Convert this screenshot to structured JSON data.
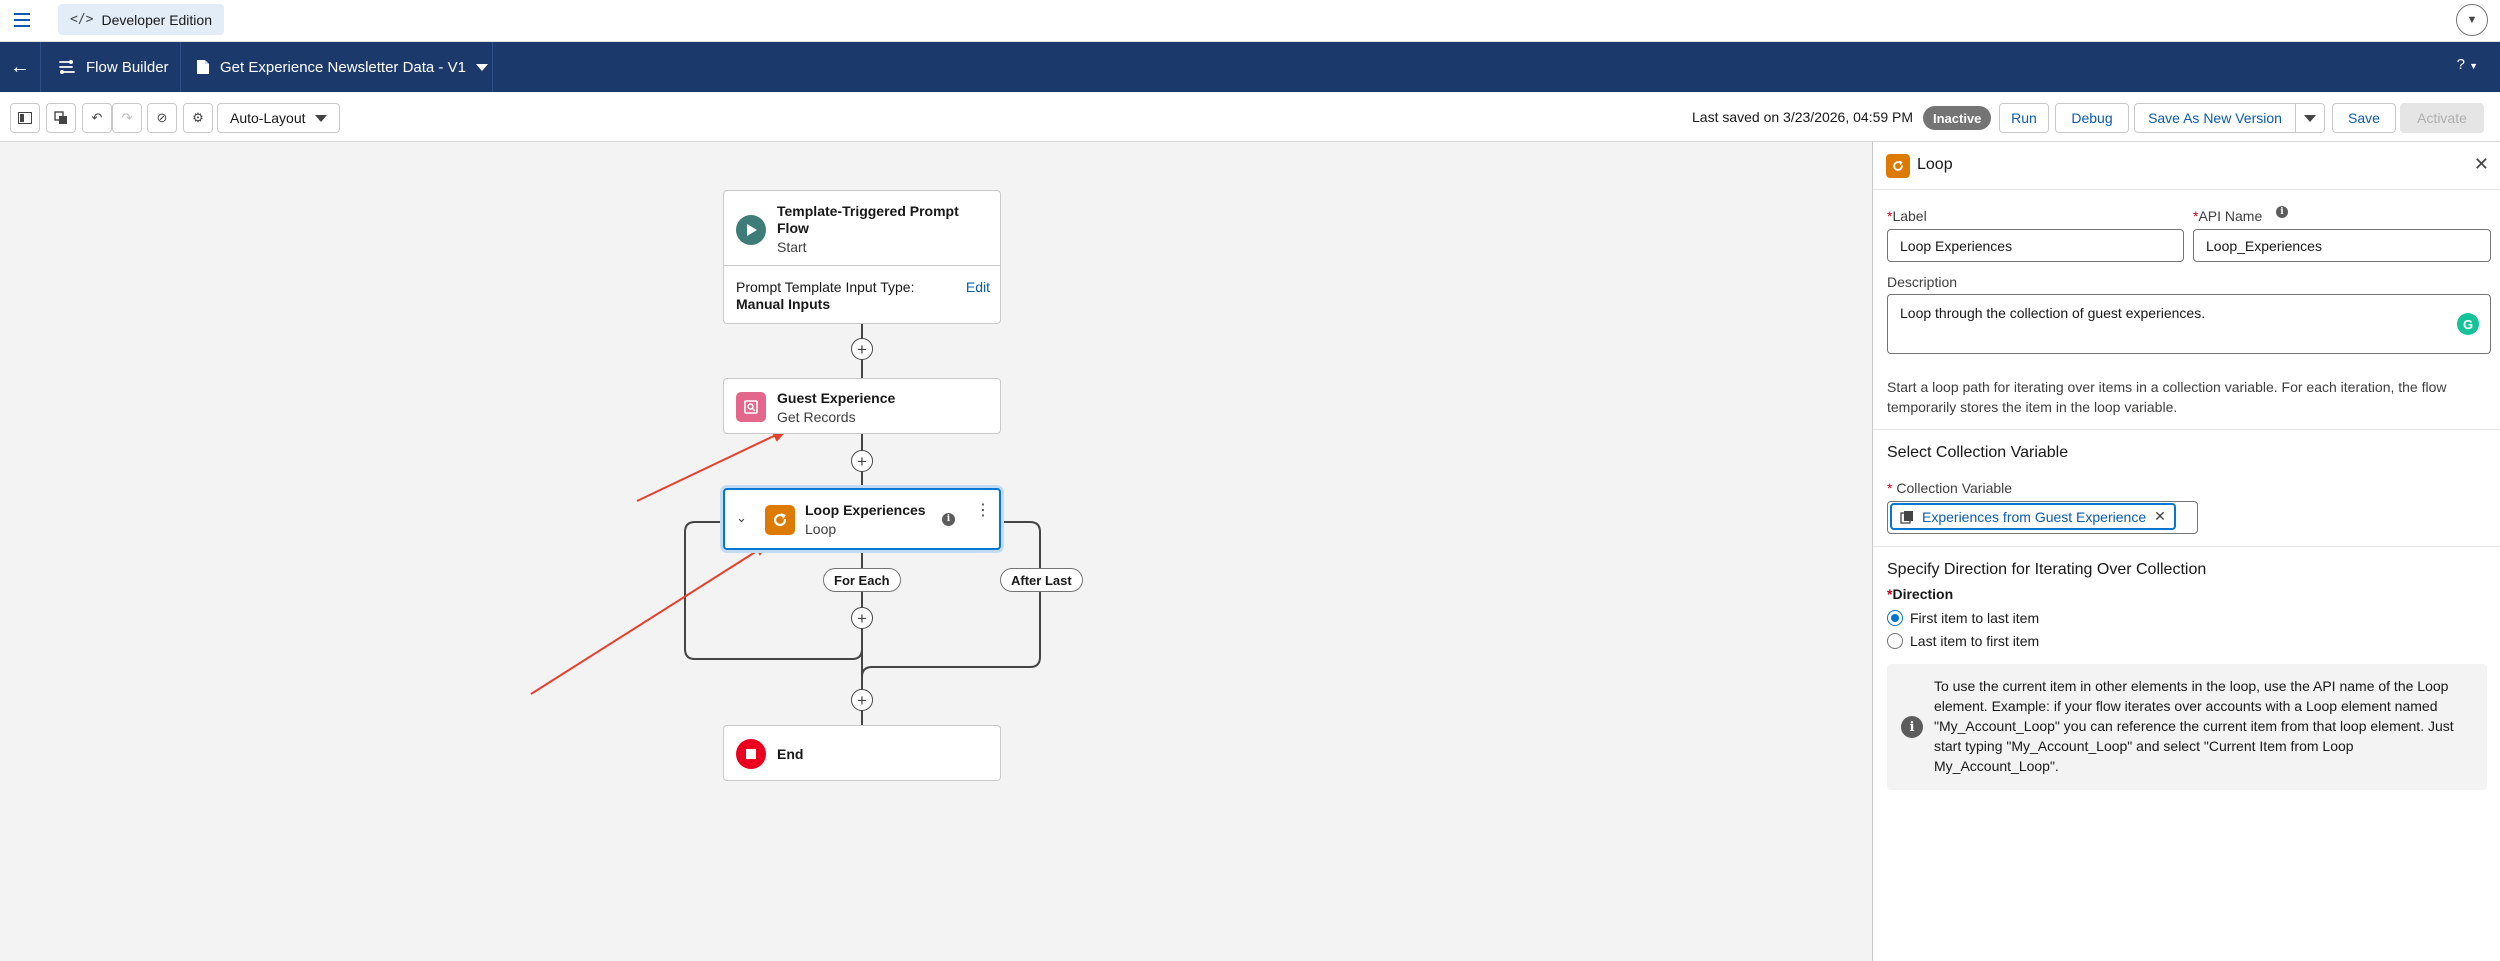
{
  "topbar": {
    "edition_label": "Developer Edition",
    "edition_icon": "code-icon"
  },
  "header": {
    "app_title": "Flow Builder",
    "flow_title": "Get Experience Newsletter Data - V1",
    "help_label": "?"
  },
  "toolbar": {
    "layout_mode": "Auto-Layout",
    "last_saved": "Last saved on 3/23/2026, 04:59 PM",
    "status_badge": "Inactive",
    "run_label": "Run",
    "debug_label": "Debug",
    "save_as_new_label": "Save As New Version",
    "save_label": "Save",
    "activate_label": "Activate"
  },
  "canvas": {
    "start": {
      "title": "Template-Triggered Prompt Flow",
      "subtitle": "Start",
      "input_type_label": "Prompt Template Input Type:",
      "input_type_value": "Manual Inputs",
      "edit_label": "Edit"
    },
    "get_records": {
      "title": "Guest Experience",
      "subtitle": "Get Records"
    },
    "loop": {
      "title": "Loop Experiences",
      "subtitle": "Loop",
      "for_each_label": "For Each",
      "after_last_label": "After Last"
    },
    "end": {
      "title": "End"
    },
    "plus_symbol": "+"
  },
  "panel": {
    "title": "Loop",
    "label_field": {
      "label": "Label",
      "value": "Loop Experiences"
    },
    "api_name_field": {
      "label": "API Name",
      "value": "Loop_Experiences"
    },
    "description_field": {
      "label": "Description",
      "value": "Loop through the collection of guest experiences."
    },
    "intro_text": "Start a loop path for iterating over items in a collection variable. For each iteration, the flow temporarily stores the item in the loop variable.",
    "collection_section_title": "Select Collection Variable",
    "collection_field": {
      "label": "Collection Variable",
      "value": "Experiences from Guest Experience"
    },
    "direction_section_title": "Specify Direction for Iterating Over Collection",
    "direction_label": "Direction",
    "direction_options": [
      {
        "label": "First item to last item",
        "selected": true
      },
      {
        "label": "Last item to first item",
        "selected": false
      }
    ],
    "info_text": "To use the current item in other elements in the loop, use the API name of the Loop element. Example: if your flow iterates over accounts with a Loop element named \"My_Account_Loop\" you can reference the current item from that loop element. Just start typing \"My_Account_Loop\" and select \"Current Item from Loop My_Account_Loop\"."
  },
  "colors": {
    "header_bg": "#1b3a6b",
    "brand_blue": "#0176d3",
    "start_icon": "#3e7d77",
    "get_records_icon": "#e3668b",
    "loop_icon": "#dd7a01",
    "end_icon": "#ea001e",
    "annotation_arrow": "#e8402f"
  }
}
